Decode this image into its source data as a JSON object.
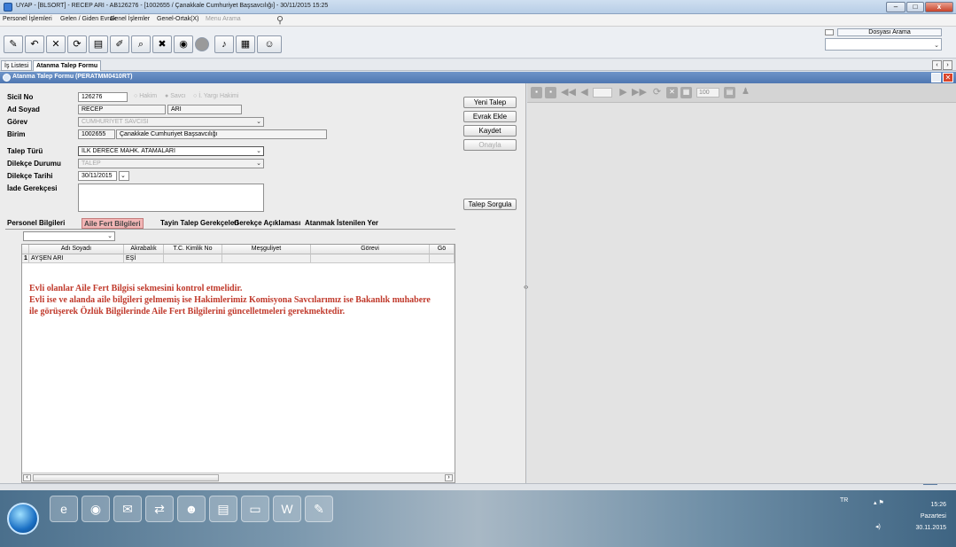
{
  "window": {
    "title": "UYAP - [BLSORT] - RECEP ARI - AB126276 - [1002655 / Çanakkale Cumhuriyet Başsavcılığı] - 30/11/2015 15:25",
    "min_label": "–",
    "max_label": "□",
    "close_label": "x"
  },
  "menu": {
    "items": [
      "Personel İşlemleri",
      "Gelen / Giden Evrak",
      "Genel İşlemler",
      "Genel-Ortak(X)"
    ],
    "search_label": "Menu Arama"
  },
  "toolbar": {
    "icons": [
      "edit-icon",
      "back-icon",
      "cancel-icon",
      "refresh-icon",
      "print-icon",
      "pen-icon",
      "zoom-icon",
      "remove-icon",
      "disk-icon",
      "info-icon",
      "note-icon",
      "calculator-icon",
      "help-icon"
    ],
    "dosya_arama_label": "Dosyası Arama"
  },
  "tabs": [
    {
      "label": "İş Listesi",
      "active": false
    },
    {
      "label": "Atanma Talep Formu",
      "active": true
    }
  ],
  "panel": {
    "title": "Atanma Talep Formu (PERATMM0410RT)"
  },
  "form": {
    "sicil_label": "Sicil No",
    "sicil_value": "126276",
    "radios": [
      "Hakim",
      "Savcı",
      "İ. Yargı Hakimi"
    ],
    "adsoyad_label": "Ad Soyad",
    "ad_value": "RECEP",
    "soyad_value": "ARI",
    "gorev_label": "Görev",
    "gorev_value": "CUMHURİYET SAVCISI",
    "birim_label": "Birim",
    "birim_code": "1002655",
    "birim_name": "Çanakkale Cumhuriyet Başsavcılığı",
    "talep_turu_label": "Talep Türü",
    "talep_turu_value": "İLK DERECE MAHK. ATAMALARI",
    "dilekce_durumu_label": "Dilekçe Durumu",
    "dilekce_durumu_value": "TALEP",
    "dilekce_tarihi_label": "Dilekçe Tarihi",
    "dilekce_tarihi_value": "30/11/2015",
    "iade_label": "İade Gerekçesi",
    "iade_value": ""
  },
  "actions": {
    "yeni_talep": "Yeni Talep",
    "evrak_ekle": "Evrak Ekle",
    "kaydet": "Kaydet",
    "onayla": "Onayla",
    "talep_sorgula": "Talep Sorgula"
  },
  "subtabs": [
    {
      "label": "Personel Bilgileri",
      "active": false
    },
    {
      "label": "Aile Fert Bilgileri",
      "active": true
    },
    {
      "label": "Tayin Talep Gerekçeleri",
      "active": false
    },
    {
      "label": "Gerekçe Açıklaması",
      "active": false
    },
    {
      "label": "Atanmak İstenilen Yer",
      "active": false
    }
  ],
  "grid": {
    "dropdown_value": "",
    "columns": [
      "",
      "Adı Soyadı",
      "Akrabalık",
      "T.C. Kimlik No",
      "Meşguliyet",
      "Görevi",
      "Gö"
    ],
    "rows": [
      [
        "1",
        "AYŞEN ARI",
        "EŞİ",
        "",
        "",
        "",
        ""
      ]
    ]
  },
  "warning": {
    "line1": "Evli olanlar Aile Fert Bilgisi sekmesini kontrol etmelidir.",
    "line2": "Evli ise ve alanda aile bilgileri gelmemiş ise Hakimlerimiz Komisyona Savcılarımız ise Bakanlık muhabere",
    "line3": "ile görüşerek Özlük Bilgilerinde Aile Fert Bilgilerini güncelletmeleri gerekmektedir."
  },
  "viewer": {
    "zoom_value": "100"
  },
  "tray": {
    "lang": "TR",
    "time": "15:26",
    "day": "Pazartesi",
    "date": "30.11.2015"
  }
}
